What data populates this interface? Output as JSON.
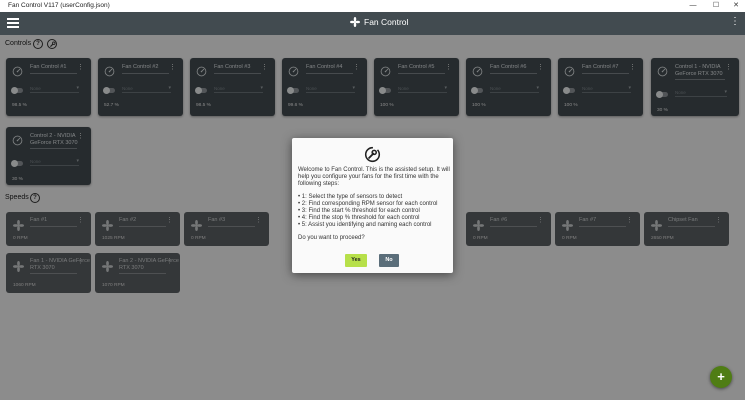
{
  "window": {
    "title": "Fan Control V117 (userConfig.json)",
    "minimize": "—",
    "maximize": "☐",
    "close": "✕"
  },
  "appbar": {
    "title": "Fan Control",
    "menu": "⋮"
  },
  "controls_section": {
    "label": "Controls",
    "help": "?"
  },
  "speeds_section": {
    "label": "Speeds",
    "help": "?"
  },
  "controls": [
    {
      "name": "Fan Control #1",
      "mode": "None",
      "value": "98.5 %"
    },
    {
      "name": "Fan Control #2",
      "mode": "None",
      "value": "52.7 %"
    },
    {
      "name": "Fan Control #3",
      "mode": "None",
      "value": "98.5 %"
    },
    {
      "name": "Fan Control #4",
      "mode": "None",
      "value": "99.6 %"
    },
    {
      "name": "Fan Control #5",
      "mode": "None",
      "value": "100 %"
    },
    {
      "name": "Fan Control #6",
      "mode": "None",
      "value": "100 %"
    },
    {
      "name": "Fan Control #7",
      "mode": "None",
      "value": "100 %"
    },
    {
      "name": "Control 1 - NVIDIA GeForce RTX 3070",
      "mode": "None",
      "value": "30 %"
    },
    {
      "name": "Control 2 - NVIDIA GeForce RTX 3070",
      "mode": "None",
      "value": "30 %"
    }
  ],
  "speeds": [
    {
      "name": "Fan #1",
      "value": "0 RPM"
    },
    {
      "name": "Fan #2",
      "value": "1025 RPM"
    },
    {
      "name": "Fan #3",
      "value": "0 RPM"
    },
    {
      "name": "Fan #6",
      "value": "0 RPM"
    },
    {
      "name": "Fan #7",
      "value": "0 RPM"
    },
    {
      "name": "Chipset Fan",
      "value": "2650 RPM"
    },
    {
      "name": "Fan 1 - NVIDIA GeForce RTX 3070",
      "value": "1060 RPM"
    },
    {
      "name": "Fan 2 - NVIDIA GeForce RTX 3070",
      "value": "1070 RPM"
    }
  ],
  "dialog": {
    "intro": "Welcome to Fan Control. This is the assisted setup. It will help you configure your fans for the first time with the following steps:",
    "steps": [
      "• 1: Select the type of sensors to detect",
      "• 2: Find corresponding RPM sensor for each control",
      "• 3: Find the start % threshold for each control",
      "• 4: Find the stop % threshold for each control",
      "• 5: Assist you identifying and naming each control"
    ],
    "question": "Do you want to proceed?",
    "yes": "Yes",
    "no": "No"
  },
  "fab": {
    "label": "+"
  }
}
